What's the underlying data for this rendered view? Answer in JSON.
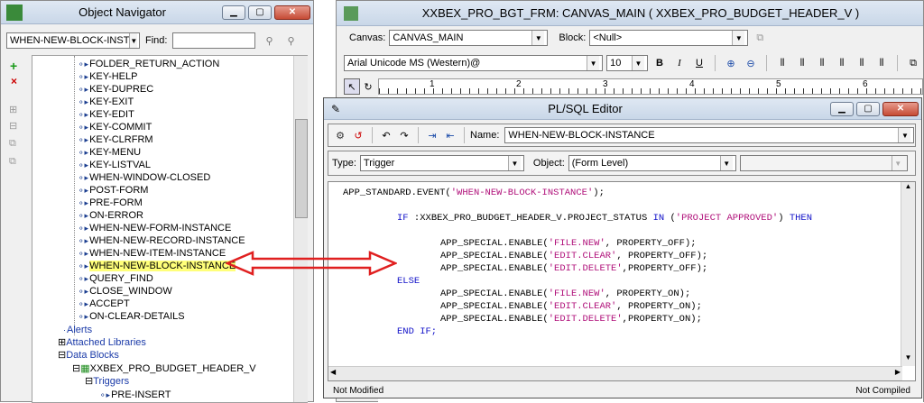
{
  "navigator": {
    "title": "Object Navigator",
    "block_select": "WHEN-NEW-BLOCK-INST",
    "find_label": "Find:",
    "items": [
      "FOLDER_RETURN_ACTION",
      "KEY-HELP",
      "KEY-DUPREC",
      "KEY-EXIT",
      "KEY-EDIT",
      "KEY-COMMIT",
      "KEY-CLRFRM",
      "KEY-MENU",
      "KEY-LISTVAL",
      "WHEN-WINDOW-CLOSED",
      "POST-FORM",
      "PRE-FORM",
      "ON-ERROR",
      "WHEN-NEW-FORM-INSTANCE",
      "WHEN-NEW-RECORD-INSTANCE",
      "WHEN-NEW-ITEM-INSTANCE",
      "WHEN-NEW-BLOCK-INSTANCE",
      "QUERY_FIND",
      "CLOSE_WINDOW",
      "ACCEPT",
      "ON-CLEAR-DETAILS"
    ],
    "alerts": "Alerts",
    "attached_libraries": "Attached Libraries",
    "data_blocks": "Data Blocks",
    "block_name": "XXBEX_PRO_BUDGET_HEADER_V",
    "triggers": "Triggers",
    "pre_insert": "PRE-INSERT"
  },
  "layout_editor": {
    "title": "XXBEX_PRO_BGT_FRM: CANVAS_MAIN ( XXBEX_PRO_BUDGET_HEADER_V )",
    "canvas_label": "Canvas:",
    "canvas_value": "CANVAS_MAIN",
    "block_label": "Block:",
    "block_value": "<Null>",
    "font_value": "Arial Unicode MS (Western)@",
    "font_size": "10",
    "bold": "B",
    "italic": "I",
    "underline": "U",
    "ruler_numbers": [
      "1",
      "2",
      "3",
      "4",
      "5",
      "6"
    ]
  },
  "plsql_editor": {
    "title": "PL/SQL Editor",
    "name_label": "Name:",
    "name_value": "WHEN-NEW-BLOCK-INSTANCE",
    "type_label": "Type:",
    "type_value": "Trigger",
    "object_label": "Object:",
    "object_value": "(Form Level)",
    "status_left": "Not Modified",
    "status_right": "Not Compiled"
  }
}
